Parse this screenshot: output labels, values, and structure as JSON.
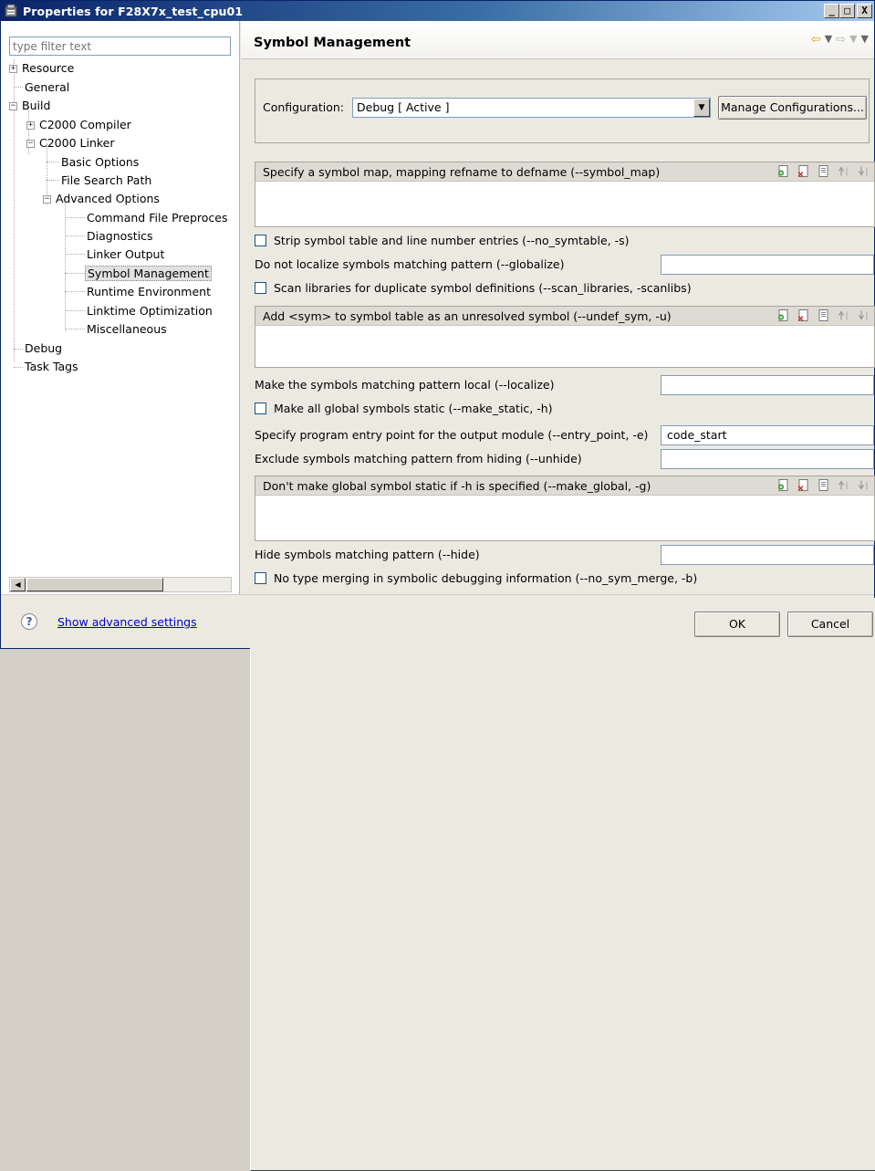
{
  "window": {
    "title": "Properties for F28X7x_test_cpu01",
    "minimize_glyph": "_",
    "maximize_glyph": "□",
    "close_glyph": "X"
  },
  "filter": {
    "placeholder": "type filter text"
  },
  "tree": {
    "resource": "Resource",
    "general": "General",
    "build": "Build",
    "c2000_compiler": "C2000 Compiler",
    "c2000_linker": "C2000 Linker",
    "basic_options": "Basic Options",
    "file_search_path": "File Search Path",
    "advanced_options": "Advanced Options",
    "command_file": "Command File Preproces",
    "diagnostics": "Diagnostics",
    "linker_output": "Linker Output",
    "symbol_management": "Symbol Management",
    "runtime_environment": "Runtime Environment",
    "linktime_optimization": "Linktime Optimization",
    "miscellaneous": "Miscellaneous",
    "debug": "Debug",
    "task_tags": "Task Tags",
    "expanded_glyph": "−",
    "collapsed_glyph": "+"
  },
  "page": {
    "title": "Symbol Management"
  },
  "config": {
    "label": "Configuration:",
    "value": "Debug  [ Active ]",
    "manage_button": "Manage Configurations..."
  },
  "options": {
    "symbol_map": "Specify a symbol map, mapping refname to defname (--symbol_map)",
    "no_symtable": "Strip symbol table and line number entries (--no_symtable, -s)",
    "globalize": "Do not localize symbols matching pattern (--globalize)",
    "scan_libraries": "Scan libraries for duplicate symbol definitions (--scan_libraries, -scanlibs)",
    "undef_sym": "Add <sym> to symbol table as an unresolved symbol (--undef_sym, -u)",
    "localize": "Make the symbols matching pattern local (--localize)",
    "make_static": "Make all global symbols static (--make_static, -h)",
    "entry_point": "Specify program entry point for the output module (--entry_point, -e)",
    "entry_point_value": "code_start",
    "unhide": "Exclude symbols matching pattern from hiding (--unhide)",
    "make_global": "Don't make global symbol static if -h is specified (--make_global, -g)",
    "hide": "Hide symbols matching pattern (--hide)",
    "no_sym_merge": "No type merging in symbolic debugging information (--no_sym_merge, -b)"
  },
  "footer": {
    "help_glyph": "?",
    "advanced_link": "Show advanced settings",
    "ok": "OK",
    "cancel": "Cancel"
  },
  "colors": {
    "title_gradient_start": "#0a246a",
    "title_gradient_end": "#a6caf0",
    "link": "#0000cc",
    "panel_bg": "#ece9e1"
  }
}
